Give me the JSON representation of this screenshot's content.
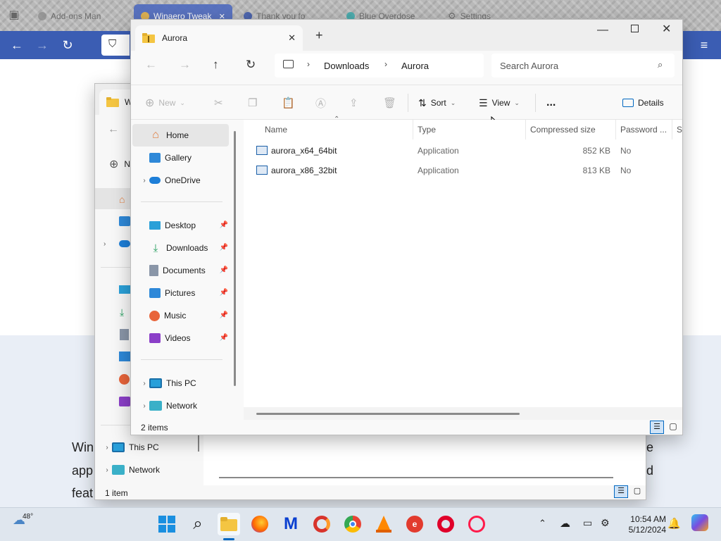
{
  "browser": {
    "tabs": [
      {
        "label": "Add-ons Man"
      },
      {
        "label": "Winaero Tweak"
      },
      {
        "label": "Thank you fo"
      },
      {
        "label": "Blue Overdose"
      },
      {
        "label": "Settings"
      }
    ],
    "page_text": [
      "Win",
      "app",
      "feat"
    ],
    "page_text_right": [
      "e",
      "d"
    ]
  },
  "back_window": {
    "tab_title": "W",
    "new_label": "N",
    "nav_items": [
      {
        "label": "This PC",
        "icon": "pc-icon"
      },
      {
        "label": "Network",
        "icon": "network-icon"
      }
    ],
    "status": "1 item"
  },
  "front_window": {
    "tab_title": "Aurora",
    "breadcrumb": [
      "Downloads",
      "Aurora"
    ],
    "search_placeholder": "Search Aurora",
    "commands": {
      "new": "New",
      "sort": "Sort",
      "view": "View",
      "more": "...",
      "details": "Details"
    },
    "nav_items": [
      {
        "label": "Home",
        "icon": "home-icon",
        "selected": true
      },
      {
        "label": "Gallery",
        "icon": "gallery-icon"
      },
      {
        "label": "OneDrive",
        "icon": "onedrive-icon",
        "expandable": true
      },
      {
        "label": "Desktop",
        "icon": "desktop-icon",
        "pinned": true
      },
      {
        "label": "Downloads",
        "icon": "downloads-icon",
        "pinned": true
      },
      {
        "label": "Documents",
        "icon": "documents-icon",
        "pinned": true
      },
      {
        "label": "Pictures",
        "icon": "pictures-icon",
        "pinned": true
      },
      {
        "label": "Music",
        "icon": "music-icon",
        "pinned": true
      },
      {
        "label": "Videos",
        "icon": "videos-icon",
        "pinned": true
      },
      {
        "label": "This PC",
        "icon": "pc-icon",
        "expandable": true
      },
      {
        "label": "Network",
        "icon": "network-icon",
        "expandable": true
      }
    ],
    "columns": [
      "Name",
      "Type",
      "Compressed size",
      "Password ...",
      "Si"
    ],
    "files": [
      {
        "name": "aurora_x64_64bit",
        "type": "Application",
        "compressed_size": "852 KB",
        "password": "No"
      },
      {
        "name": "aurora_x86_32bit",
        "type": "Application",
        "compressed_size": "813 KB",
        "password": "No"
      }
    ],
    "status": "2 items"
  },
  "taskbar": {
    "weather_temp": "48°",
    "time": "10:54 AM",
    "date": "5/12/2024",
    "apps": [
      "start-icon",
      "search-icon",
      "file-explorer-icon",
      "firefox-icon",
      "malwarebytes-icon",
      "ccleaner-icon",
      "chrome-icon",
      "vlc-icon",
      "app-icon",
      "opera-icon",
      "opera-gx-icon"
    ]
  },
  "colors": {
    "browser_bar": "#3b5db3",
    "accent": "#0067c0",
    "folder": "#f4c542"
  }
}
